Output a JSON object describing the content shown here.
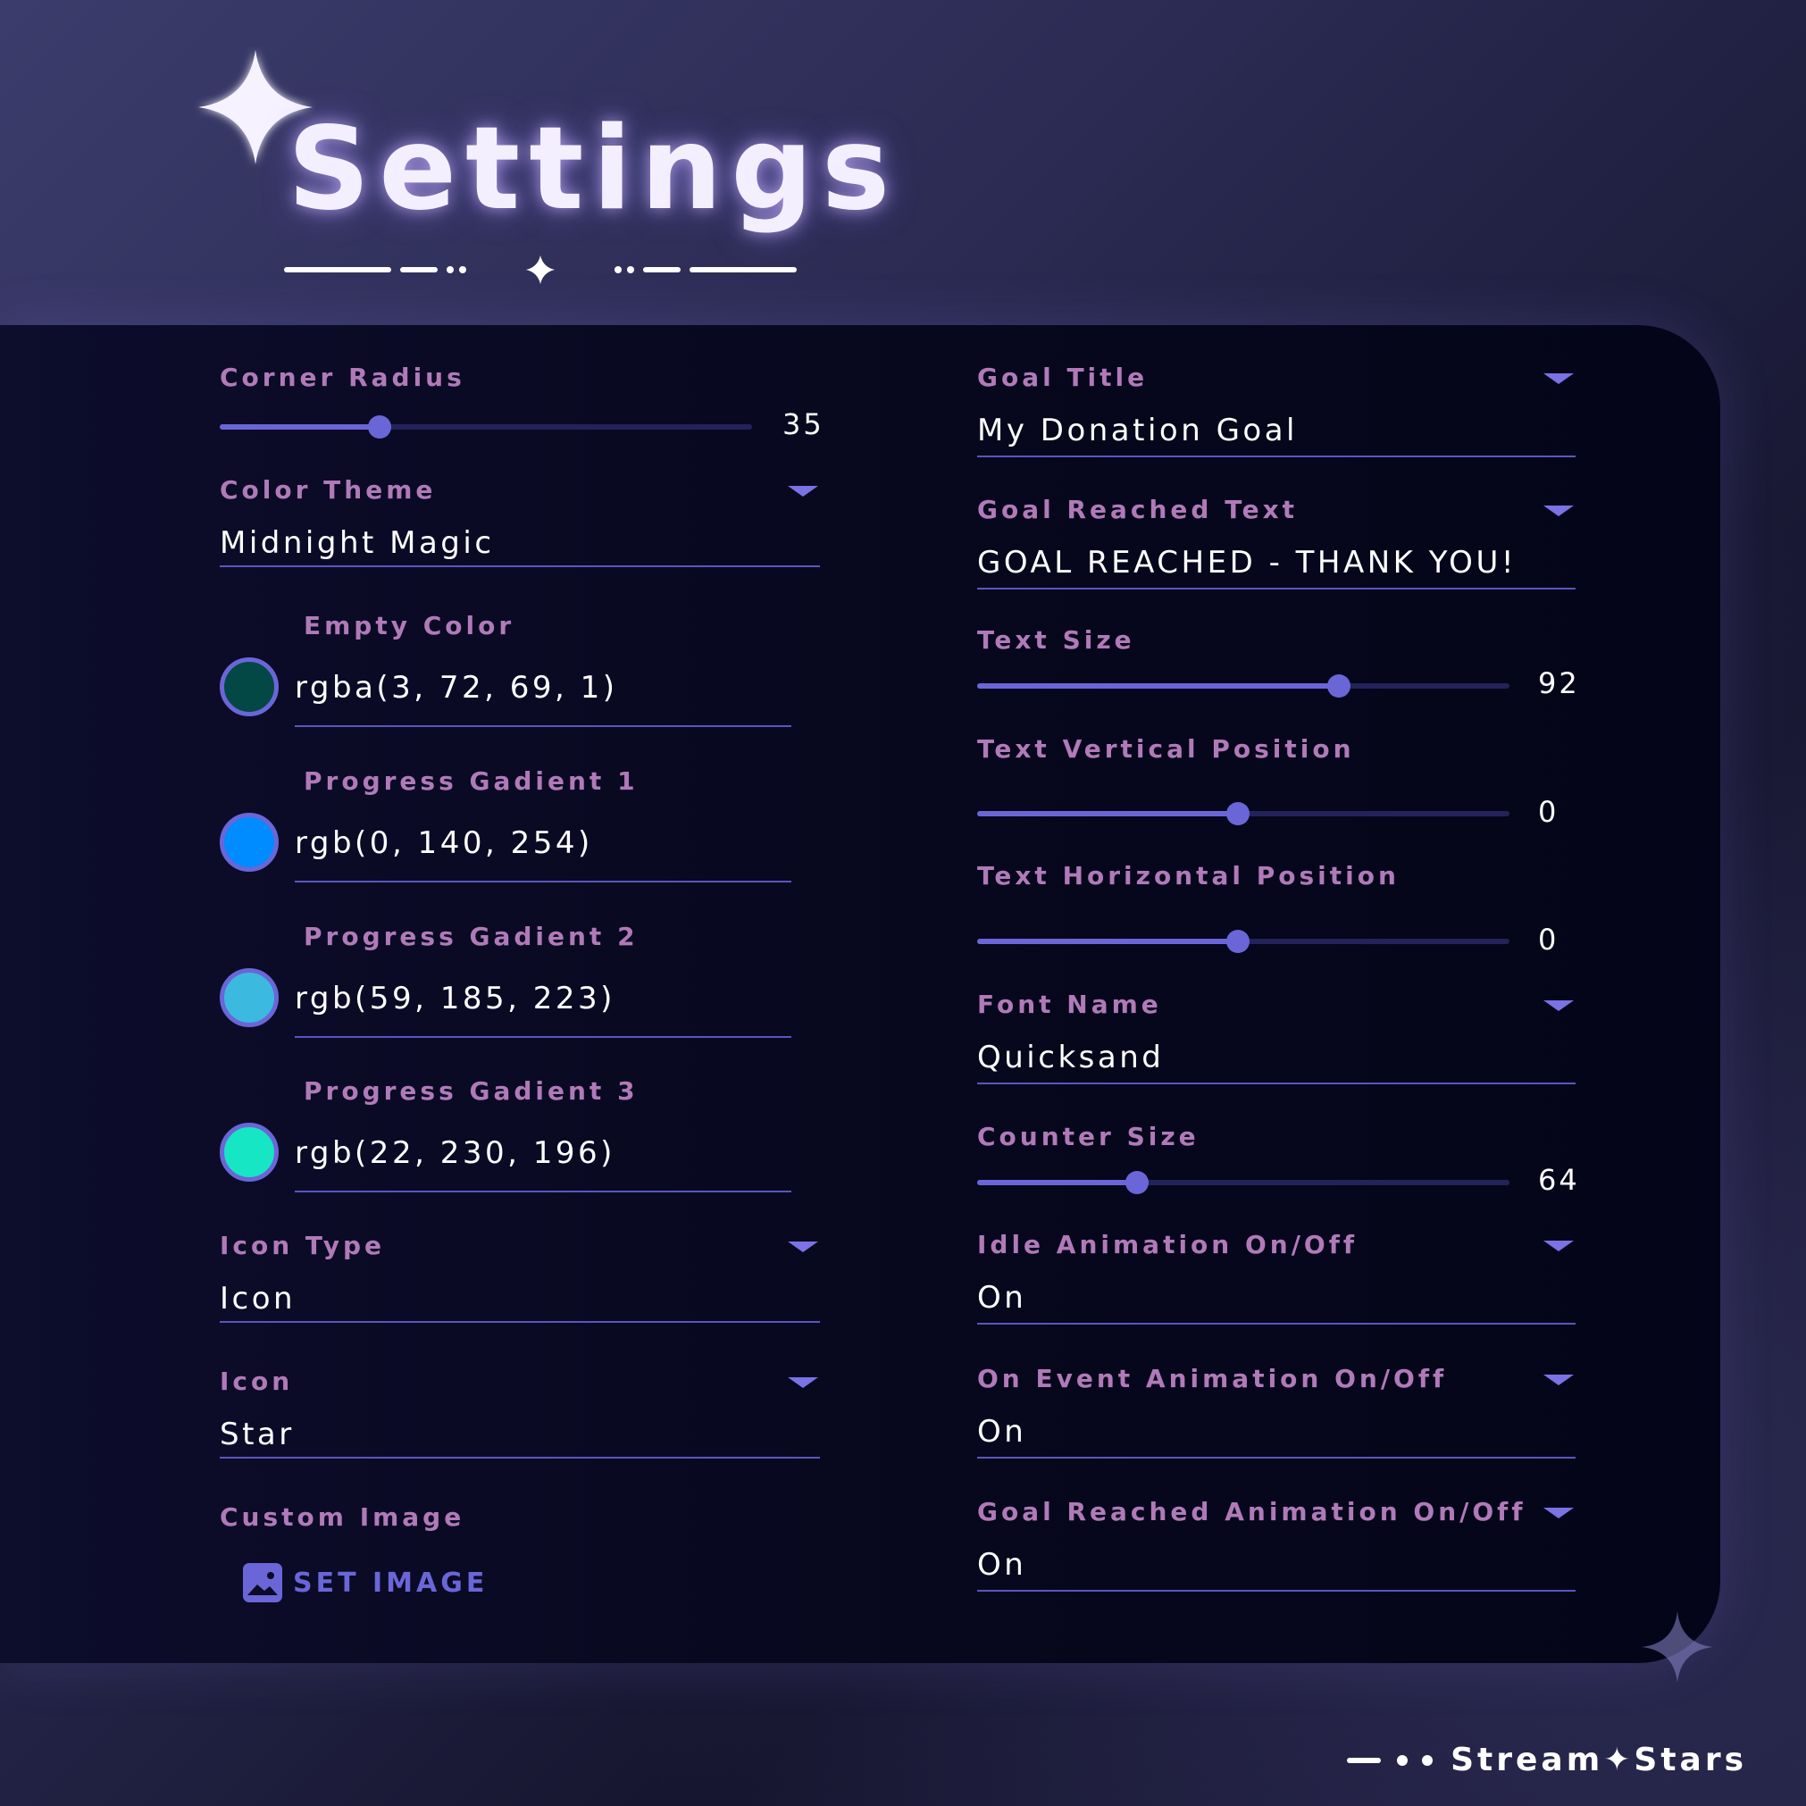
{
  "header": {
    "title": "Settings"
  },
  "left_column": {
    "corner_radius": {
      "label": "Corner Radius",
      "value": "35",
      "level": 0.3
    },
    "color_theme": {
      "label": "Color Theme",
      "value": "Midnight Magic"
    },
    "empty_color": {
      "label": "Empty Color",
      "value": "rgba(3, 72, 69, 1)",
      "swatch": "#034845"
    },
    "progress_gradient_1": {
      "label": "Progress Gadient 1",
      "value": "rgb(0, 140, 254)",
      "swatch": "#008cfe"
    },
    "progress_gradient_2": {
      "label": "Progress Gadient 2",
      "value": "rgb(59, 185, 223)",
      "swatch": "#3bb9df"
    },
    "progress_gradient_3": {
      "label": "Progress Gadient 3",
      "value": "rgb(22, 230, 196)",
      "swatch": "#16e6c4"
    },
    "icon_type": {
      "label": "Icon Type",
      "value": "Icon"
    },
    "icon": {
      "label": "Icon",
      "value": "Star"
    },
    "custom_image": {
      "label": "Custom Image",
      "button_label": "SET IMAGE"
    }
  },
  "right_column": {
    "goal_title": {
      "label": "Goal Title",
      "value": "My Donation Goal"
    },
    "goal_reached_text": {
      "label": "Goal Reached Text",
      "value": "GOAL REACHED - THANK YOU!"
    },
    "text_size": {
      "label": "Text Size",
      "value": "92",
      "level": 0.68
    },
    "text_vertical_position": {
      "label": "Text Vertical Position",
      "value": "0",
      "level": 0.49
    },
    "text_horizontal_position": {
      "label": "Text Horizontal Position",
      "value": "0",
      "level": 0.49
    },
    "font_name": {
      "label": "Font Name",
      "value": "Quicksand"
    },
    "counter_size": {
      "label": "Counter Size",
      "value": "64",
      "level": 0.3
    },
    "idle_animation": {
      "label": "Idle Animation On/Off",
      "value": "On"
    },
    "on_event_animation": {
      "label": "On Event Animation On/Off",
      "value": "On"
    },
    "goal_reached_animation": {
      "label": "Goal Reached Animation On/Off",
      "value": "On"
    }
  },
  "brand": {
    "text": "Stream✦Stars"
  },
  "colors": {
    "accent": "#6a66d8",
    "label": "#b07ab8",
    "panel": "#08081f"
  }
}
